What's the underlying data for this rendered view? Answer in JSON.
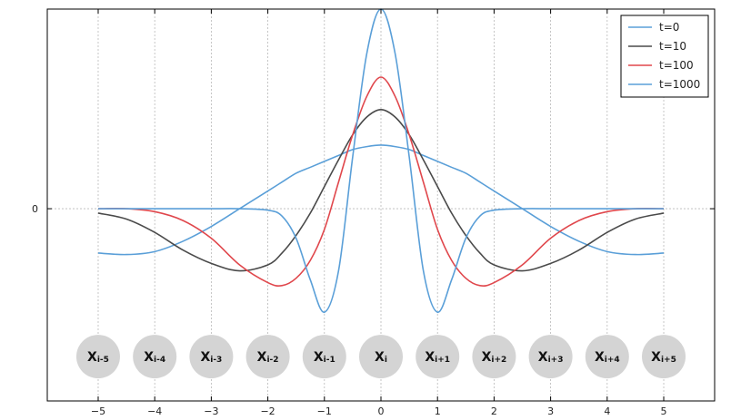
{
  "chart_data": {
    "type": "line",
    "title": "",
    "xlabel": "",
    "ylabel": "",
    "xlim": [
      -5.9,
      5.9
    ],
    "ylim": [
      -1.3,
      1.35
    ],
    "xticks": [
      -5,
      -4,
      -3,
      -2,
      -1,
      0,
      1,
      2,
      3,
      4,
      5
    ],
    "xtick_labels": [
      "−5",
      "−4",
      "−3",
      "−2",
      "−1",
      "0",
      "1",
      "2",
      "3",
      "4",
      "5"
    ],
    "yticks": [
      0
    ],
    "ytick_labels": [
      "0"
    ],
    "grid": true,
    "legend_position": "top-right",
    "x": [
      -5,
      -4.5,
      -4,
      -3.5,
      -3,
      -2.5,
      -2,
      -1.75,
      -1.5,
      -1.25,
      -1,
      -0.75,
      -0.5,
      -0.25,
      0,
      0.25,
      0.5,
      0.75,
      1,
      1.25,
      1.5,
      1.75,
      2,
      2.5,
      3,
      3.5,
      4,
      4.5,
      5
    ],
    "series": [
      {
        "name": "t=0",
        "color": "#5a9fd8",
        "values": [
          -0.3,
          -0.31,
          -0.29,
          -0.22,
          -0.12,
          0.0,
          0.12,
          0.18,
          0.24,
          0.28,
          0.32,
          0.36,
          0.4,
          0.42,
          0.43,
          0.42,
          0.4,
          0.36,
          0.32,
          0.28,
          0.24,
          0.18,
          0.12,
          0.0,
          -0.12,
          -0.22,
          -0.29,
          -0.31,
          -0.3
        ]
      },
      {
        "name": "t=10",
        "color": "#4a4a4a",
        "values": [
          -0.03,
          -0.07,
          -0.16,
          -0.28,
          -0.37,
          -0.42,
          -0.38,
          -0.3,
          -0.18,
          -0.03,
          0.15,
          0.33,
          0.5,
          0.62,
          0.67,
          0.62,
          0.5,
          0.33,
          0.15,
          -0.03,
          -0.18,
          -0.3,
          -0.38,
          -0.42,
          -0.37,
          -0.28,
          -0.16,
          -0.07,
          -0.03
        ]
      },
      {
        "name": "t=100",
        "color": "#e0474c",
        "values": [
          0.0,
          0.0,
          -0.02,
          -0.08,
          -0.2,
          -0.38,
          -0.5,
          -0.52,
          -0.47,
          -0.35,
          -0.14,
          0.18,
          0.5,
          0.76,
          0.89,
          0.76,
          0.5,
          0.18,
          -0.14,
          -0.35,
          -0.47,
          -0.52,
          -0.5,
          -0.38,
          -0.2,
          -0.08,
          -0.02,
          0.0,
          0.0
        ]
      },
      {
        "name": "t=1000",
        "color": "#5a9fd8",
        "values": [
          0.0,
          0.0,
          0.0,
          0.0,
          0.0,
          0.0,
          -0.01,
          -0.05,
          -0.2,
          -0.48,
          -0.7,
          -0.42,
          0.35,
          1.05,
          1.35,
          1.05,
          0.35,
          -0.42,
          -0.7,
          -0.48,
          -0.2,
          -0.05,
          -0.01,
          0.0,
          0.0,
          0.0,
          0.0,
          0.0,
          0.0
        ]
      }
    ],
    "annotations": {
      "row_y": -1.0,
      "nodes": [
        {
          "x": -5,
          "main": "X",
          "sub": "i-5"
        },
        {
          "x": -4,
          "main": "X",
          "sub": "i-4"
        },
        {
          "x": -3,
          "main": "X",
          "sub": "i-3"
        },
        {
          "x": -2,
          "main": "X",
          "sub": "i-2"
        },
        {
          "x": -1,
          "main": "X",
          "sub": "i-1"
        },
        {
          "x": 0,
          "main": "X",
          "sub": "i"
        },
        {
          "x": 1,
          "main": "X",
          "sub": "i+1"
        },
        {
          "x": 2,
          "main": "X",
          "sub": "i+2"
        },
        {
          "x": 3,
          "main": "X",
          "sub": "i+3"
        },
        {
          "x": 4,
          "main": "X",
          "sub": "i+4"
        },
        {
          "x": 5,
          "main": "X",
          "sub": "i+5"
        }
      ]
    }
  }
}
